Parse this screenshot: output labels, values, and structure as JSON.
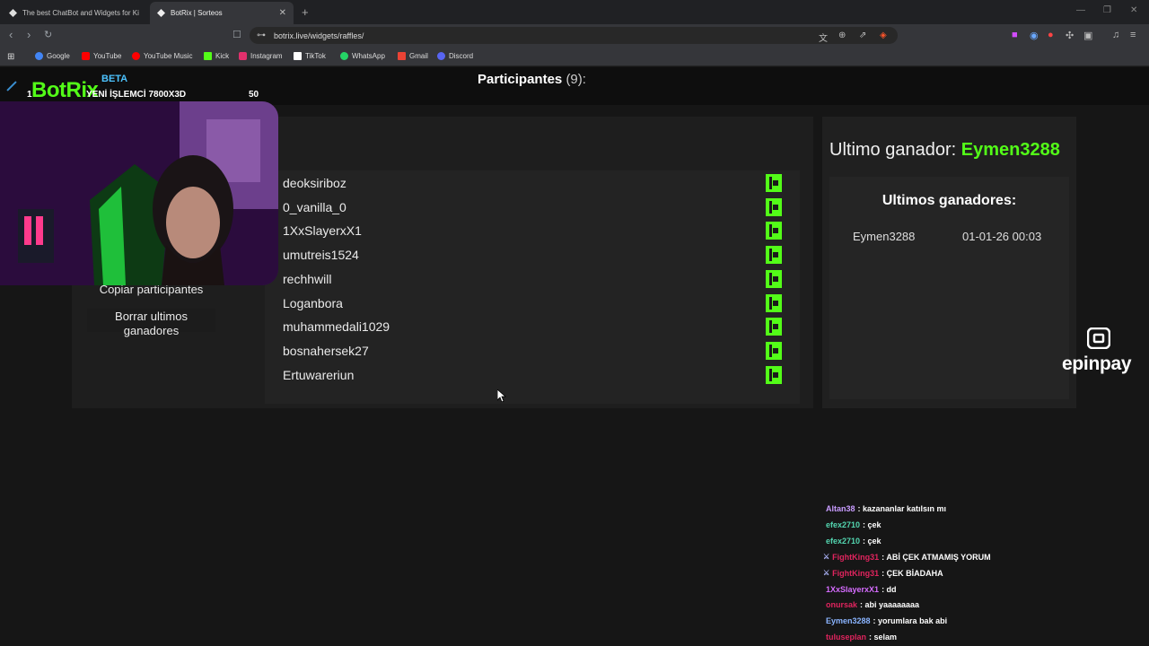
{
  "browser": {
    "tabs": [
      {
        "title": "The best ChatBot and Widgets for Ki",
        "active": false
      },
      {
        "title": "BotRix | Sorteos",
        "active": true
      }
    ],
    "url": "botrix.live/widgets/raffles/",
    "bookmarks": [
      {
        "label": "Google",
        "color": "#4285f4"
      },
      {
        "label": "YouTube",
        "color": "#ff0000"
      },
      {
        "label": "YouTube Music",
        "color": "#ff0000"
      },
      {
        "label": "Kick",
        "color": "#53fc18"
      },
      {
        "label": "Instagram",
        "color": "#e1306c"
      },
      {
        "label": "TikTok",
        "color": "#ffffff"
      },
      {
        "label": "WhatsApp",
        "color": "#25d366"
      },
      {
        "label": "Gmail",
        "color": "#ea4335"
      },
      {
        "label": "Discord",
        "color": "#5865f2"
      }
    ]
  },
  "overlay": {
    "logo": "BotRix",
    "beta": "BETA",
    "rank": "1",
    "ticker": "YENİ İŞLEMCİ 7800X3D",
    "count": "50"
  },
  "raffle": {
    "title": "Participantes",
    "count_text": "(9):",
    "participants": [
      "deoksiriboz",
      "0_vanilla_0",
      "1XxSlayerxX1",
      "umutreis1524",
      "rechhwill",
      "Loganbora",
      "muhammedali1029",
      "bosnahersek27",
      "Ertuwareriun"
    ],
    "platform_icon": "kick-icon",
    "accent": "#53fc18"
  },
  "actions": {
    "copy_label": "Copiar participantes",
    "clear_label": "Borrar ultimos ganadores"
  },
  "winners": {
    "last_label": "Ultimo ganador:",
    "last_name": "Eymen3288",
    "title": "Ultimos ganadores:",
    "rows": [
      {
        "user": "Eymen3288",
        "date": "01-01-26 00:03"
      }
    ]
  },
  "sponsor": {
    "name": "epinpay"
  },
  "chat": [
    {
      "user": "Altan38",
      "color": "#c89cff",
      "msg": ": kazananlar katılsın mı",
      "badge": false
    },
    {
      "user": "efex2710",
      "color": "#53d6b0",
      "msg": ": çek",
      "badge": false
    },
    {
      "user": "efex2710",
      "color": "#53d6b0",
      "msg": ": çek",
      "badge": false
    },
    {
      "user": "FightKing31",
      "color": "#e0245e",
      "msg": ": ABİ ÇEK ATMAMIŞ YORUM",
      "badge": true
    },
    {
      "user": "FightKing31",
      "color": "#e0245e",
      "msg": ": ÇEK BİADAHA",
      "badge": true
    },
    {
      "user": "1XxSlayerxX1",
      "color": "#d66cff",
      "msg": ": dd",
      "badge": false
    },
    {
      "user": "onursak",
      "color": "#e0245e",
      "msg": ": abi yaaaaaaaa",
      "badge": false
    },
    {
      "user": "Eymen3288",
      "color": "#8ab4ff",
      "msg": ": yorumlara bak abi",
      "badge": false
    },
    {
      "user": "tuluseplan",
      "color": "#e0245e",
      "msg": ": selam",
      "badge": false
    }
  ]
}
